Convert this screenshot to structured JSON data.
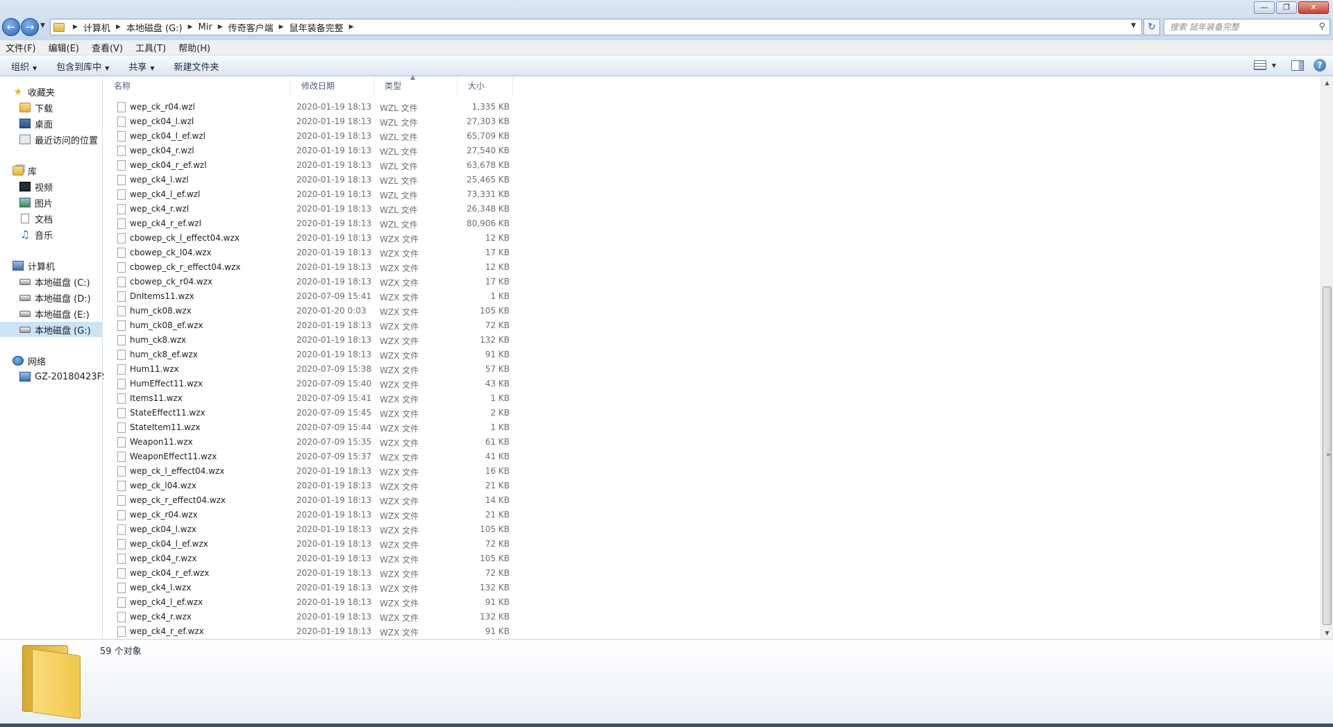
{
  "window": {
    "controls": {
      "minimize": "—",
      "maximize": "❐",
      "close": "✕"
    }
  },
  "address": {
    "breadcrumbs": [
      "计算机",
      "本地磁盘 (G:)",
      "Mir",
      "传奇客户端",
      "鼠年装备完整"
    ],
    "search_placeholder": "搜索 鼠年装备完整"
  },
  "menu": [
    "文件(F)",
    "编辑(E)",
    "查看(V)",
    "工具(T)",
    "帮助(H)"
  ],
  "toolbar": {
    "organize": "组织",
    "include_in_library": "包含到库中",
    "share": "共享",
    "new_folder": "新建文件夹"
  },
  "nav": {
    "favorites": "收藏夹",
    "downloads": "下载",
    "desktop": "桌面",
    "recent": "最近访问的位置",
    "libraries": "库",
    "videos": "视频",
    "pictures": "图片",
    "documents": "文档",
    "music": "音乐",
    "computer": "计算机",
    "drive_c": "本地磁盘 (C:)",
    "drive_d": "本地磁盘 (D:)",
    "drive_e": "本地磁盘 (E:)",
    "drive_g": "本地磁盘 (G:)",
    "network": "网络",
    "network_pc": "GZ-20180423FSJ"
  },
  "columns": {
    "name": "名称",
    "modified": "修改日期",
    "type": "类型",
    "size": "大小"
  },
  "files": [
    {
      "name": "wep_ck_r04.wzl",
      "date": "2020-01-19 18:13",
      "type": "WZL 文件",
      "size": "1,335 KB"
    },
    {
      "name": "wep_ck04_l.wzl",
      "date": "2020-01-19 18:13",
      "type": "WZL 文件",
      "size": "27,303 KB"
    },
    {
      "name": "wep_ck04_l_ef.wzl",
      "date": "2020-01-19 18:13",
      "type": "WZL 文件",
      "size": "65,709 KB"
    },
    {
      "name": "wep_ck04_r.wzl",
      "date": "2020-01-19 18:13",
      "type": "WZL 文件",
      "size": "27,540 KB"
    },
    {
      "name": "wep_ck04_r_ef.wzl",
      "date": "2020-01-19 18:13",
      "type": "WZL 文件",
      "size": "63,678 KB"
    },
    {
      "name": "wep_ck4_l.wzl",
      "date": "2020-01-19 18:13",
      "type": "WZL 文件",
      "size": "25,465 KB"
    },
    {
      "name": "wep_ck4_l_ef.wzl",
      "date": "2020-01-19 18:13",
      "type": "WZL 文件",
      "size": "73,331 KB"
    },
    {
      "name": "wep_ck4_r.wzl",
      "date": "2020-01-19 18:13",
      "type": "WZL 文件",
      "size": "26,348 KB"
    },
    {
      "name": "wep_ck4_r_ef.wzl",
      "date": "2020-01-19 18:13",
      "type": "WZL 文件",
      "size": "80,906 KB"
    },
    {
      "name": "cbowep_ck_l_effect04.wzx",
      "date": "2020-01-19 18:13",
      "type": "WZX 文件",
      "size": "12 KB"
    },
    {
      "name": "cbowep_ck_l04.wzx",
      "date": "2020-01-19 18:13",
      "type": "WZX 文件",
      "size": "17 KB"
    },
    {
      "name": "cbowep_ck_r_effect04.wzx",
      "date": "2020-01-19 18:13",
      "type": "WZX 文件",
      "size": "12 KB"
    },
    {
      "name": "cbowep_ck_r04.wzx",
      "date": "2020-01-19 18:13",
      "type": "WZX 文件",
      "size": "17 KB"
    },
    {
      "name": "DnItems11.wzx",
      "date": "2020-07-09 15:41",
      "type": "WZX 文件",
      "size": "1 KB"
    },
    {
      "name": "hum_ck08.wzx",
      "date": "2020-01-20 0:03",
      "type": "WZX 文件",
      "size": "105 KB"
    },
    {
      "name": "hum_ck08_ef.wzx",
      "date": "2020-01-19 18:13",
      "type": "WZX 文件",
      "size": "72 KB"
    },
    {
      "name": "hum_ck8.wzx",
      "date": "2020-01-19 18:13",
      "type": "WZX 文件",
      "size": "132 KB"
    },
    {
      "name": "hum_ck8_ef.wzx",
      "date": "2020-01-19 18:13",
      "type": "WZX 文件",
      "size": "91 KB"
    },
    {
      "name": "Hum11.wzx",
      "date": "2020-07-09 15:38",
      "type": "WZX 文件",
      "size": "57 KB"
    },
    {
      "name": "HumEffect11.wzx",
      "date": "2020-07-09 15:40",
      "type": "WZX 文件",
      "size": "43 KB"
    },
    {
      "name": "Items11.wzx",
      "date": "2020-07-09 15:41",
      "type": "WZX 文件",
      "size": "1 KB"
    },
    {
      "name": "StateEffect11.wzx",
      "date": "2020-07-09 15:45",
      "type": "WZX 文件",
      "size": "2 KB"
    },
    {
      "name": "StateItem11.wzx",
      "date": "2020-07-09 15:44",
      "type": "WZX 文件",
      "size": "1 KB"
    },
    {
      "name": "Weapon11.wzx",
      "date": "2020-07-09 15:35",
      "type": "WZX 文件",
      "size": "61 KB"
    },
    {
      "name": "WeaponEffect11.wzx",
      "date": "2020-07-09 15:37",
      "type": "WZX 文件",
      "size": "41 KB"
    },
    {
      "name": "wep_ck_l_effect04.wzx",
      "date": "2020-01-19 18:13",
      "type": "WZX 文件",
      "size": "16 KB"
    },
    {
      "name": "wep_ck_l04.wzx",
      "date": "2020-01-19 18:13",
      "type": "WZX 文件",
      "size": "21 KB"
    },
    {
      "name": "wep_ck_r_effect04.wzx",
      "date": "2020-01-19 18:13",
      "type": "WZX 文件",
      "size": "14 KB"
    },
    {
      "name": "wep_ck_r04.wzx",
      "date": "2020-01-19 18:13",
      "type": "WZX 文件",
      "size": "21 KB"
    },
    {
      "name": "wep_ck04_l.wzx",
      "date": "2020-01-19 18:13",
      "type": "WZX 文件",
      "size": "105 KB"
    },
    {
      "name": "wep_ck04_l_ef.wzx",
      "date": "2020-01-19 18:13",
      "type": "WZX 文件",
      "size": "72 KB"
    },
    {
      "name": "wep_ck04_r.wzx",
      "date": "2020-01-19 18:13",
      "type": "WZX 文件",
      "size": "105 KB"
    },
    {
      "name": "wep_ck04_r_ef.wzx",
      "date": "2020-01-19 18:13",
      "type": "WZX 文件",
      "size": "72 KB"
    },
    {
      "name": "wep_ck4_l.wzx",
      "date": "2020-01-19 18:13",
      "type": "WZX 文件",
      "size": "132 KB"
    },
    {
      "name": "wep_ck4_l_ef.wzx",
      "date": "2020-01-19 18:13",
      "type": "WZX 文件",
      "size": "91 KB"
    },
    {
      "name": "wep_ck4_r.wzx",
      "date": "2020-01-19 18:13",
      "type": "WZX 文件",
      "size": "132 KB"
    },
    {
      "name": "wep_ck4_r_ef.wzx",
      "date": "2020-01-19 18:13",
      "type": "WZX 文件",
      "size": "91 KB"
    }
  ],
  "status": {
    "object_count": "59 个对象"
  }
}
